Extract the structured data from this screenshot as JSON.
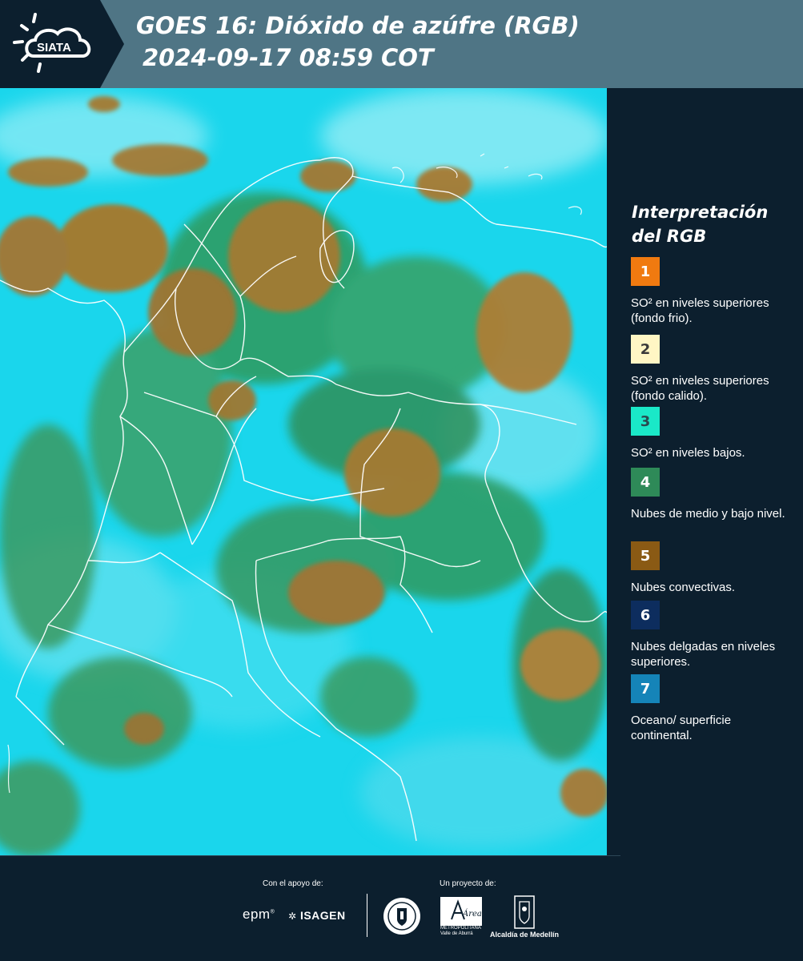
{
  "header": {
    "logo_text": "SIATA",
    "title_line1": "GOES 16: Dióxido de azúfre (RGB)",
    "title_line2": "2024-09-17 08:59 COT"
  },
  "map": {
    "description_colors": {
      "background": "#1ad6ec",
      "cloud_convective": "#a67a2e",
      "cloud_mid_low": "#2f9a5a",
      "border_lines": "#ffffff"
    }
  },
  "legend": {
    "title": "Interpretación del RGB",
    "items": [
      {
        "number": "1",
        "text": "SO² en niveles superiores (fondo frio).",
        "color": "#f07a10",
        "number_color": "#ffffff"
      },
      {
        "number": "2",
        "text": "SO² en niveles superiores (fondo calido).",
        "color": "#fff6c4",
        "number_color": "#3a3a3a"
      },
      {
        "number": "3",
        "text": "SO² en niveles bajos.",
        "color": "#1ae8c8",
        "number_color": "#2a4a50"
      },
      {
        "number": "4",
        "text": "Nubes de medio y bajo nivel.",
        "color": "#2e8a58",
        "number_color": "#ffffff"
      },
      {
        "number": "5",
        "text": "Nubes convectivas.",
        "color": "#8a5a14",
        "number_color": "#ffffff"
      },
      {
        "number": "6",
        "text": "Nubes delgadas en niveles superiores.",
        "color": "#0d2d5e",
        "number_color": "#ffffff"
      },
      {
        "number": "7",
        "text": "Oceano/ superficie continental.",
        "color": "#1584b8",
        "number_color": "#ffffff"
      }
    ]
  },
  "footer": {
    "support_label": "Con el apoyo de:",
    "project_label": "Un proyecto de:",
    "sponsor_epm": "epm",
    "sponsor_epm_mark": "®",
    "sponsor_isagen": "ISAGEN",
    "area_name": "Área",
    "area_sub": "METROPOLITANA Valle de Aburrá",
    "alcaldia": "Alcaldía de Medellín"
  }
}
